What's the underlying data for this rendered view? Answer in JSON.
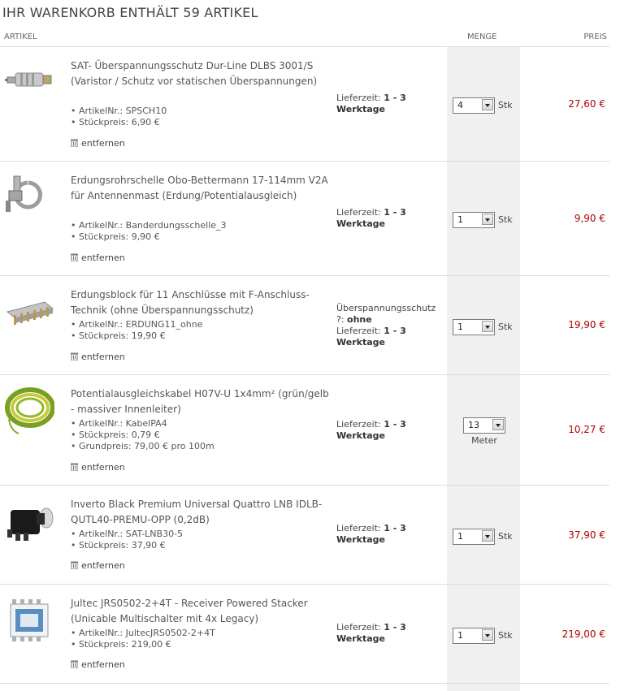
{
  "cart": {
    "title": "IHR WARENKORB ENTHÄLT 59 ARTIKEL",
    "headers": {
      "article": "ARTIKEL",
      "quantity": "MENGE",
      "price": "PREIS"
    },
    "remove_label": "entfernen",
    "items": [
      {
        "name": "SAT- Überspannungsschutz Dur-Line DLBS 3001/S (Varistor / Schutz vor statischen Überspannungen)",
        "meta": [
          "• ArtikelNr.: SPSCH10",
          "• Stückpreis: 6,90 €"
        ],
        "delivery_prefix": "",
        "delivery_option": "",
        "delivery_label": "Lieferzeit: ",
        "delivery_value": "1 - 3",
        "delivery_unit": "Werktage",
        "qty": "4",
        "unit": "Stk",
        "price": "27,60 €",
        "icon": "surge-protector-image"
      },
      {
        "name": "Erdungsrohrschelle Obo-Bettermann 17-114mm V2A für Antennenmast (Erdung/Potentialausgleich)",
        "meta": [
          "• ArtikelNr.: Banderdungsschelle_3",
          "• Stückpreis: 9,90 €"
        ],
        "delivery_prefix": "",
        "delivery_option": "",
        "delivery_label": "Lieferzeit: ",
        "delivery_value": "1 - 3",
        "delivery_unit": "Werktage",
        "qty": "1",
        "unit": "Stk",
        "price": "9,90 €",
        "icon": "pipe-clamp-image"
      },
      {
        "name": "Erdungsblock für 11 Anschlüsse mit F-Anschluss-Technik (ohne Überspannungsschutz)",
        "meta": [
          "• ArtikelNr.: ERDUNG11_ohne",
          "• Stückpreis: 19,90 €"
        ],
        "delivery_prefix": "Überspannungsschutz ?: ",
        "delivery_option": "ohne",
        "delivery_label": "Lieferzeit: ",
        "delivery_value": "1 - 3",
        "delivery_unit": "Werktage",
        "qty": "1",
        "unit": "Stk",
        "price": "19,90 €",
        "icon": "grounding-block-image"
      },
      {
        "name": "Potentialausgleichskabel H07V-U 1x4mm² (grün/gelb - massiver Innenleiter)",
        "meta": [
          "• ArtikelNr.: KabelPA4",
          "• Stückpreis: 0,79 €",
          "• Grundpreis: 79,00 € pro 100m"
        ],
        "delivery_prefix": "",
        "delivery_option": "",
        "delivery_label": "Lieferzeit: ",
        "delivery_value": "1 - 3",
        "delivery_unit": "Werktage",
        "qty": "13",
        "unit": "Meter",
        "price": "10,27 €",
        "icon": "cable-coil-image"
      },
      {
        "name": "Inverto Black Premium Universal Quattro LNB IDLB-QUTL40-PREMU-OPP (0,2dB)",
        "meta": [
          "• ArtikelNr.: SAT-LNB30-5",
          "• Stückpreis: 37,90 €"
        ],
        "delivery_prefix": "",
        "delivery_option": "",
        "delivery_label": "Lieferzeit: ",
        "delivery_value": "1 - 3",
        "delivery_unit": "Werktage",
        "qty": "1",
        "unit": "Stk",
        "price": "37,90 €",
        "icon": "lnb-image"
      },
      {
        "name": "Jultec JRS0502-2+4T - Receiver Powered Stacker (Unicable Multischalter mit 4x Legacy)",
        "meta": [
          "• ArtikelNr.: JultecJRS0502-2+4T",
          "• Stückpreis: 219,00 €"
        ],
        "delivery_prefix": "",
        "delivery_option": "",
        "delivery_label": "Lieferzeit: ",
        "delivery_value": "1 - 3",
        "delivery_unit": "Werktage",
        "qty": "1",
        "unit": "Stk",
        "price": "219,00 €",
        "icon": "multiswitch-image"
      }
    ]
  }
}
